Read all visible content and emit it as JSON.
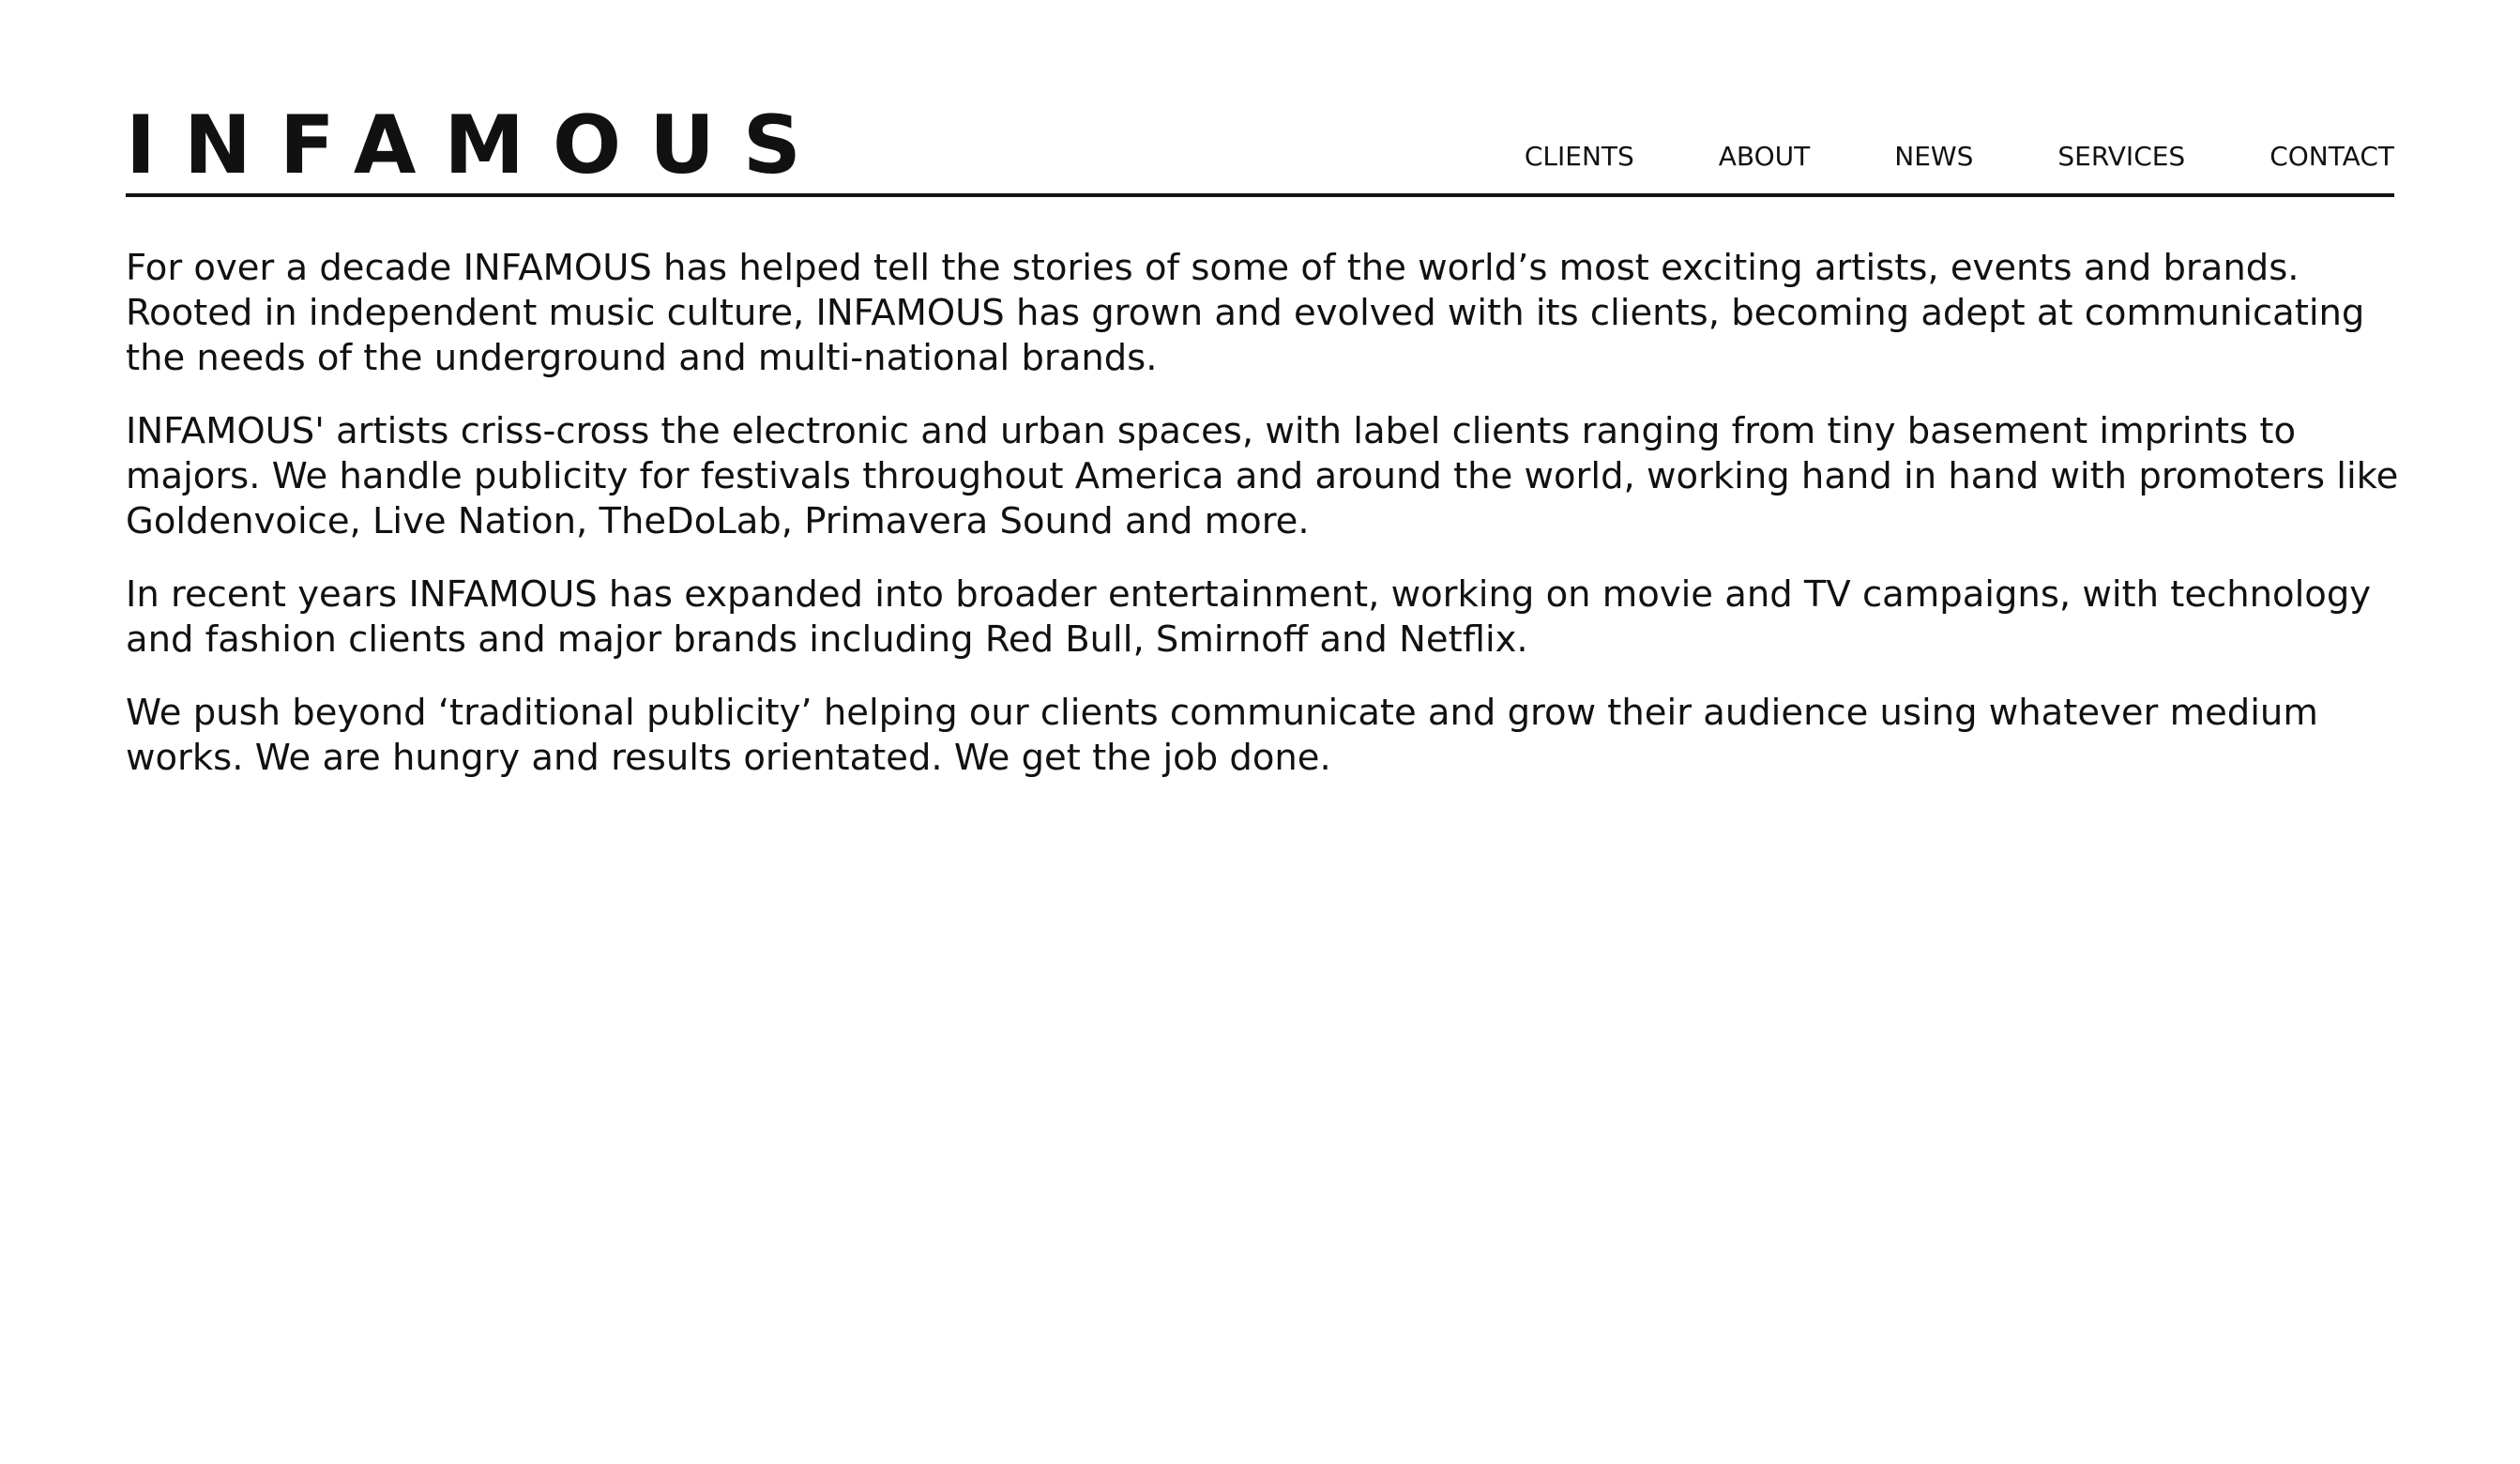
{
  "brand": {
    "logo_text": "INFAMOUS"
  },
  "nav": {
    "items": [
      {
        "label": "CLIENTS"
      },
      {
        "label": "ABOUT"
      },
      {
        "label": "NEWS"
      },
      {
        "label": "SERVICES"
      },
      {
        "label": "CONTACT"
      }
    ]
  },
  "content": {
    "paragraphs": [
      "For over a decade INFAMOUS has helped tell the stories of some of the world’s most exciting artists, events and brands. Rooted in independent music culture, INFAMOUS has grown and evolved with its clients, becoming adept at communicating the needs of the underground and multi-national brands.",
      "INFAMOUS' artists criss-cross the electronic and urban spaces, with label clients ranging from tiny basement imprints to majors. We handle publicity for festivals throughout America and around the world, working hand in hand with promoters like Goldenvoice, Live Nation, TheDoLab, Primavera Sound and more.",
      "In recent years INFAMOUS has expanded into broader entertainment, working on movie and TV campaigns, with technology and fashion clients and major brands including Red Bull, Smirnoff and Netflix.",
      "We push beyond ‘traditional publicity’ helping our clients communicate and grow their audience using whatever medium works. We are hungry and results orientated. We get the job done."
    ]
  },
  "colors": {
    "background": "#ffffff",
    "text": "#111111",
    "rule": "#111111"
  }
}
